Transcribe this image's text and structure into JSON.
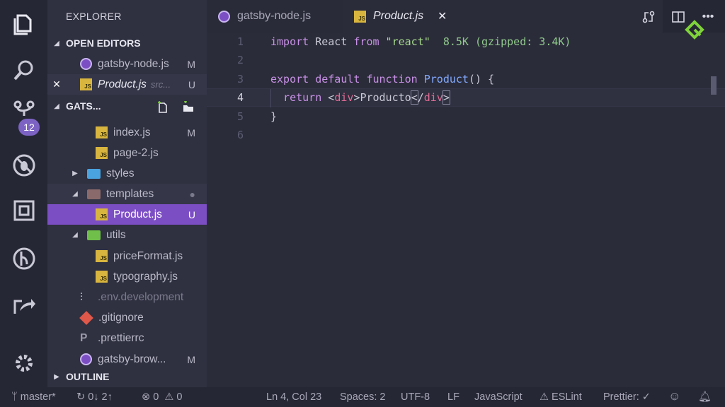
{
  "activity": {
    "scm_badge": "12"
  },
  "sidebar": {
    "title": "EXPLORER",
    "open_editors": {
      "label": "OPEN EDITORS",
      "items": [
        {
          "name": "gatsby-node.js",
          "status": "M"
        },
        {
          "name": "Product.js",
          "path": "src...",
          "status": "U"
        }
      ]
    },
    "project": {
      "label": "GATS...",
      "items": [
        {
          "name": "index.js",
          "status": "M"
        },
        {
          "name": "page-2.js",
          "status": ""
        },
        {
          "name": "styles",
          "status": ""
        },
        {
          "name": "templates",
          "status": "●"
        },
        {
          "name": "Product.js",
          "status": "U"
        },
        {
          "name": "utils",
          "status": ""
        },
        {
          "name": "priceFormat.js",
          "status": ""
        },
        {
          "name": "typography.js",
          "status": ""
        },
        {
          "name": ".env.development",
          "status": ""
        },
        {
          "name": ".gitignore",
          "status": ""
        },
        {
          "name": ".prettierrc",
          "status": ""
        },
        {
          "name": "gatsby-brow...",
          "status": "M"
        }
      ]
    },
    "outline": {
      "label": "OUTLINE"
    }
  },
  "tabs": [
    {
      "label": "gatsby-node.js"
    },
    {
      "label": "Product.js",
      "close": "✕"
    }
  ],
  "editor": {
    "line_numbers": [
      "1",
      "2",
      "3",
      "4",
      "5",
      "6"
    ],
    "line1": {
      "import": "import",
      "react_id": " React ",
      "from": "from",
      "module": " \"react\"",
      "hint": "  8.5K (gzipped: 3.4K)"
    },
    "line3": {
      "export": "export",
      "default": " default",
      "function": " function",
      "name": " Product",
      "rest": "() {"
    },
    "line4": {
      "return": "  return ",
      "lt": "<",
      "tag_open": "div",
      "gt": ">",
      "text": "Producto",
      "close_lt": "<",
      "slash": "/",
      "tag_close": "div",
      "close_gt": ">"
    },
    "line5": {
      "text": "}"
    }
  },
  "statusbar": {
    "branch": "master*",
    "sync": "0↓ 2↑",
    "errors": "0",
    "warnings": "0",
    "position": "Ln 4, Col 23",
    "spaces": "Spaces: 2",
    "encoding": "UTF-8",
    "eol": "LF",
    "language": "JavaScript",
    "eslint": "ESLint",
    "prettier": "Prettier: ✓"
  },
  "colors": {
    "accent": "#7c4ec4",
    "badge": "#7c63c3",
    "logo": "#7fd33a"
  }
}
